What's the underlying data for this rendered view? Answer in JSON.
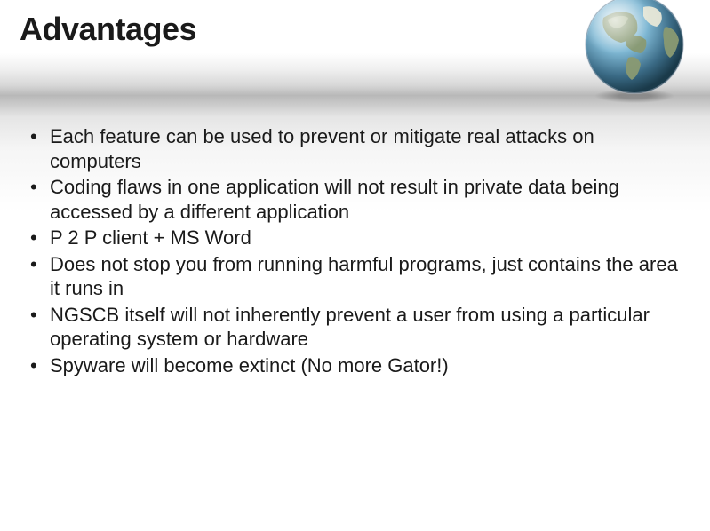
{
  "title": "Advantages",
  "bullets": [
    "Each feature can be used to prevent or mitigate real attacks on computers",
    "Coding flaws in one application will not result in private data being accessed by a different application",
    "P 2 P client + MS Word",
    "Does not stop you from running harmful programs, just contains the area it runs in",
    "NGSCB itself will not inherently prevent a user from using a particular operating system or hardware",
    "Spyware will become extinct (No more Gator!)"
  ],
  "globe_icon_name": "globe-icon"
}
